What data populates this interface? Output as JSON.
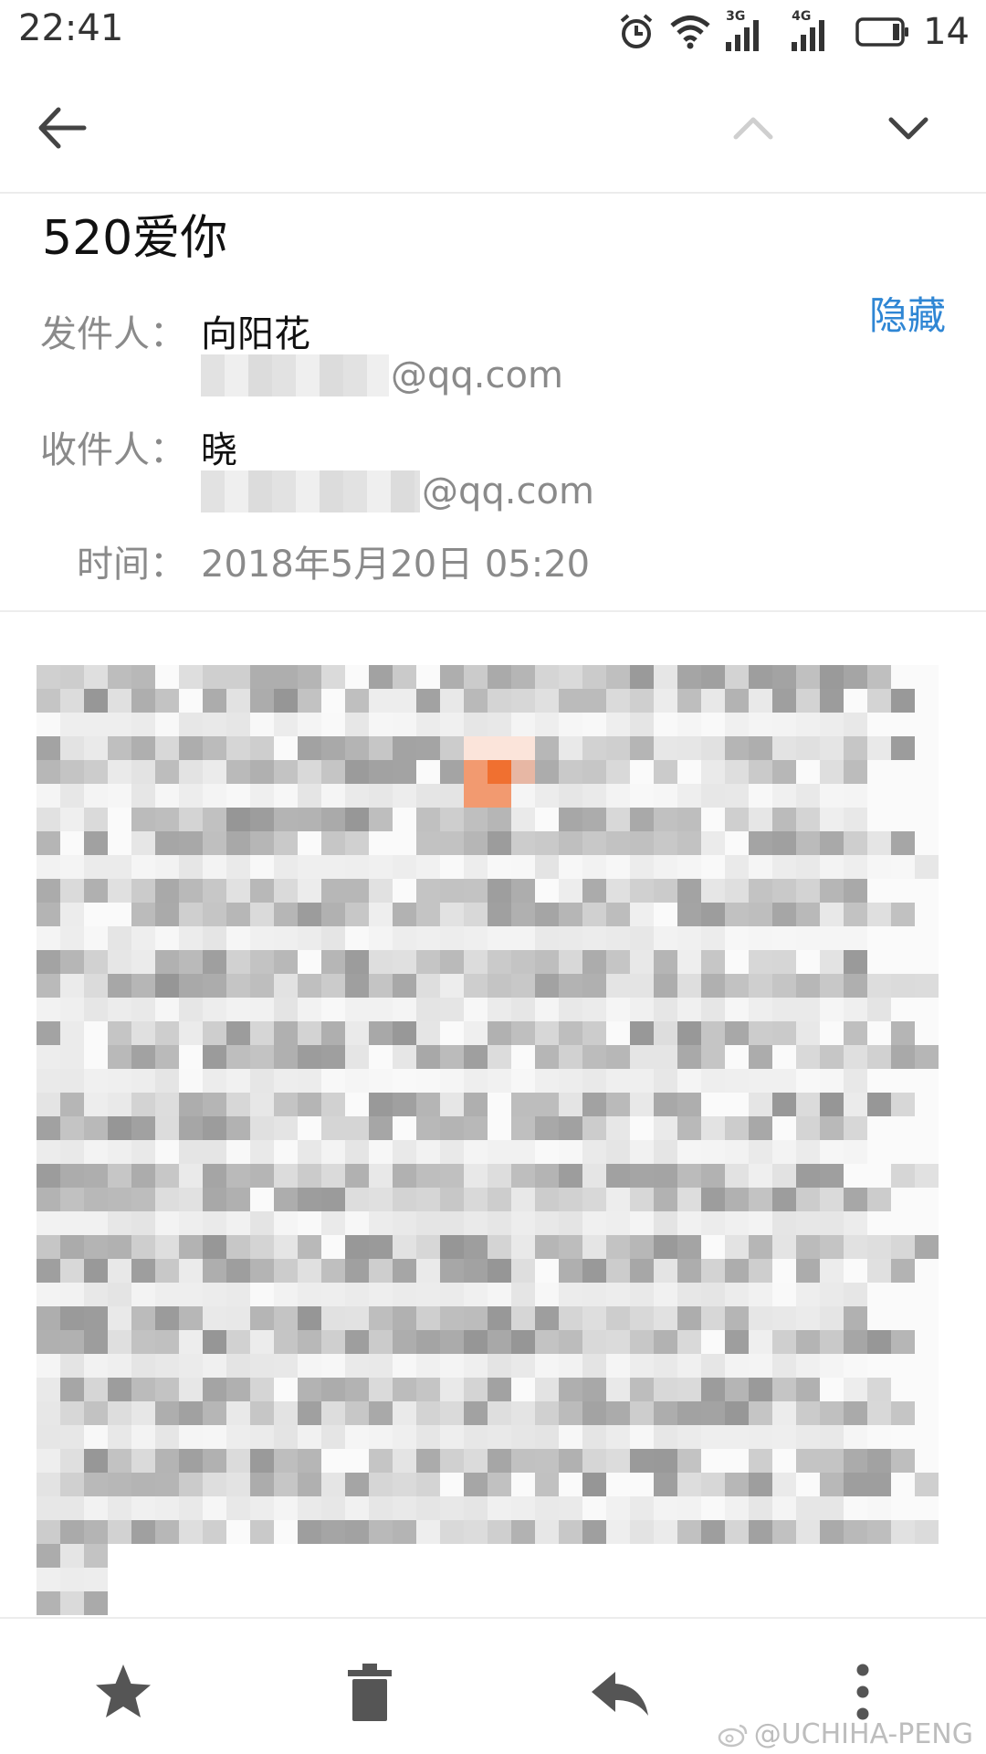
{
  "status_bar": {
    "time": "22:41",
    "battery_text": "14",
    "signal_1_tag": "3G",
    "signal_2_tag": "4G",
    "icons": [
      "alarm-icon",
      "wifi-icon",
      "signal-3g-icon",
      "signal-4g-icon",
      "battery-icon"
    ]
  },
  "header": {
    "icons": [
      "back-arrow-icon",
      "chevron-up-icon",
      "chevron-down-icon"
    ]
  },
  "email": {
    "subject": "520爱你",
    "hide_label": "隐藏",
    "sender_label": "发件人：",
    "sender_name": "向阳花",
    "sender_addr_suffix": "@qq.com",
    "recipient_label": "收件人：",
    "recipient_name": "晓",
    "recipient_addr_suffix": "@qq.com",
    "time_label": "时间：",
    "time_value": "2018年5月20日 05:20"
  },
  "toolbar": {
    "icons": [
      "star-icon",
      "trash-icon",
      "reply-icon",
      "more-vertical-icon"
    ]
  },
  "watermark": {
    "text": "@UCHIHA-PENG",
    "icon": "weibo-icon"
  },
  "colors": {
    "accent": "#2f86d4",
    "text_primary": "#111111",
    "text_secondary": "#8a8a8a",
    "mosaic_highlight": "#f07030"
  }
}
